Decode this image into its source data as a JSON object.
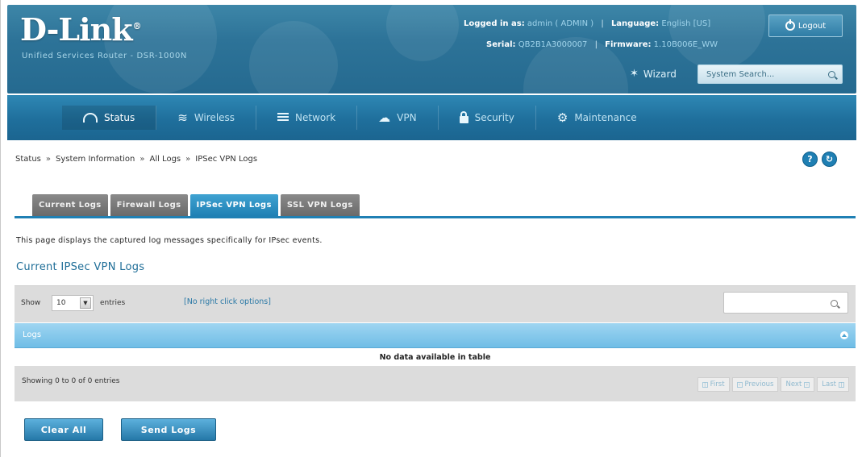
{
  "brand": {
    "logo": "D-Link",
    "logo_mark": "®",
    "subtitle": "Unified Services Router - DSR-1000N"
  },
  "session": {
    "logged_in_label": "Logged in as:",
    "logged_in_value": "admin ( ADMIN )",
    "language_label": "Language:",
    "language_value": "English [US]",
    "serial_label": "Serial:",
    "serial_value": "QB2B1A3000007",
    "firmware_label": "Firmware:",
    "firmware_value": "1.10B006E_WW",
    "logout_label": "Logout",
    "wizard_label": "Wizard",
    "system_search_label": "System Search..."
  },
  "nav": [
    {
      "label": "Status",
      "icon": "gauge-icon",
      "active": true
    },
    {
      "label": "Wireless",
      "icon": "wifi-icon",
      "active": false
    },
    {
      "label": "Network",
      "icon": "network-icon",
      "active": false
    },
    {
      "label": "VPN",
      "icon": "cloud-icon",
      "active": false
    },
    {
      "label": "Security",
      "icon": "lock-icon",
      "active": false
    },
    {
      "label": "Maintenance",
      "icon": "gears-icon",
      "active": false
    }
  ],
  "breadcrumb": [
    "Status",
    "System Information",
    "All Logs",
    "IPSec VPN Logs"
  ],
  "breadcrumb_sep": "»",
  "help_buttons": {
    "help": "?",
    "refresh": "↻"
  },
  "tabs": [
    {
      "label": "Current Logs",
      "active": false
    },
    {
      "label": "Firewall Logs",
      "active": false
    },
    {
      "label": "IPSec VPN Logs",
      "active": true
    },
    {
      "label": "SSL VPN Logs",
      "active": false
    }
  ],
  "description": "This page displays the captured log messages specifically for IPsec events.",
  "section_title": "Current IPSec VPN Logs",
  "table": {
    "show_label": "Show",
    "entries_value": "10",
    "entries_label": "entries",
    "right_click_note": "[No right click options]",
    "column_header": "Logs",
    "empty_message": "No data available in table",
    "showing_text": "Showing 0 to 0 of 0 entries",
    "pager": {
      "first": "First",
      "previous": "Previous",
      "next": "Next",
      "last": "Last"
    }
  },
  "actions": {
    "clear_all": "Clear All",
    "send_logs": "Send Logs"
  },
  "colors": {
    "header_blue": "#2d7398",
    "nav_blue": "#1f6f9c",
    "active_tab": "#1f80b4",
    "table_header": "#7fc4e9"
  }
}
